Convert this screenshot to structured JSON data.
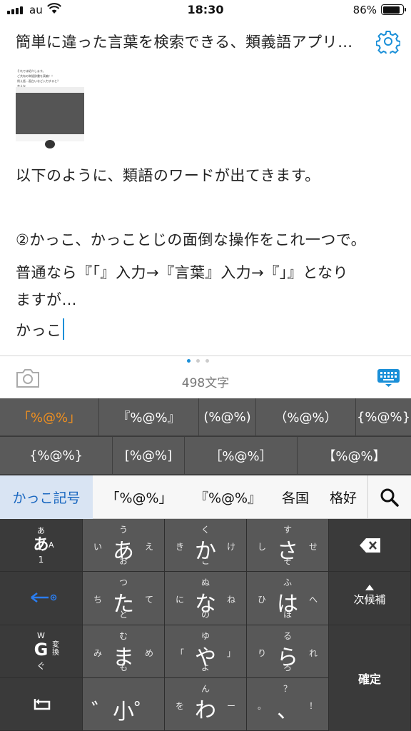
{
  "status": {
    "carrier": "au",
    "time": "18:30",
    "battery": "86%",
    "battery_level": 0.86
  },
  "titlebar": {
    "title": "簡単に違った言葉を検索できる、類義語アプリ…",
    "settings_icon": "gear-icon"
  },
  "thumbnail": {
    "lines": [
      "それでは紹介します。",
      "ご共有の単語辞書を表編！！",
      "例え話…面白いなど入力すると？",
      "言えな"
    ]
  },
  "document": {
    "line1": "以下のように、類語のワードが出てきます。",
    "line2": "②かっこ、かっことじの面倒な操作をこれ一つで。",
    "line3": "普通なら『「』入力→『言葉』入力→『」』となり",
    "line4": "ますが…",
    "line5": "かっこ"
  },
  "editor_toolbar": {
    "char_count": "498文字",
    "camera_icon": "camera-icon",
    "keyboard_icon": "keyboard-icon"
  },
  "candidates_row1": [
    "「%@%」",
    "『%@%』",
    "(%@%)",
    "（%@%）",
    "{%@%}"
  ],
  "candidates_row2": [
    "{%@%}",
    "[%@%]",
    "［%@%］",
    "【%@%】"
  ],
  "suggestions": {
    "selected": "かっこ記号",
    "items": [
      "「%@%」",
      "『%@%』",
      "各国",
      "格好"
    ]
  },
  "keyboard": {
    "mode_key": {
      "main": "あ",
      "top": "あ",
      "right": "A",
      "bottom": "1"
    },
    "keys": [
      {
        "main": "あ",
        "t": "う",
        "l": "い",
        "r": "え",
        "b": "お"
      },
      {
        "main": "か",
        "t": "く",
        "l": "き",
        "r": "け",
        "b": "こ"
      },
      {
        "main": "さ",
        "t": "す",
        "l": "し",
        "r": "せ",
        "b": "そ"
      },
      {
        "main": "た",
        "t": "つ",
        "l": "ち",
        "r": "て",
        "b": "と"
      },
      {
        "main": "な",
        "t": "ぬ",
        "l": "に",
        "r": "ね",
        "b": "の"
      },
      {
        "main": "は",
        "t": "ふ",
        "l": "ひ",
        "r": "へ",
        "b": "ほ"
      },
      {
        "main": "ま",
        "t": "む",
        "l": "み",
        "r": "め",
        "b": "も"
      },
      {
        "main": "や",
        "t": "ゆ",
        "l": "「",
        "r": "」",
        "b": "よ"
      },
      {
        "main": "ら",
        "t": "る",
        "l": "り",
        "r": "れ",
        "b": "ろ"
      },
      {
        "main": "゛小゜",
        "t": "",
        "l": "",
        "r": "",
        "b": ""
      },
      {
        "main": "わ",
        "t": "ん",
        "l": "を",
        "r": "ー",
        "b": ""
      },
      {
        "main": "、",
        "t": "？",
        "l": "。",
        "r": "！",
        "b": ""
      }
    ],
    "g_key": {
      "main": "G",
      "top": "W",
      "right": "変換",
      "bottom": "ぐ"
    },
    "next_candidate": "次候補",
    "confirm": "確定"
  }
}
